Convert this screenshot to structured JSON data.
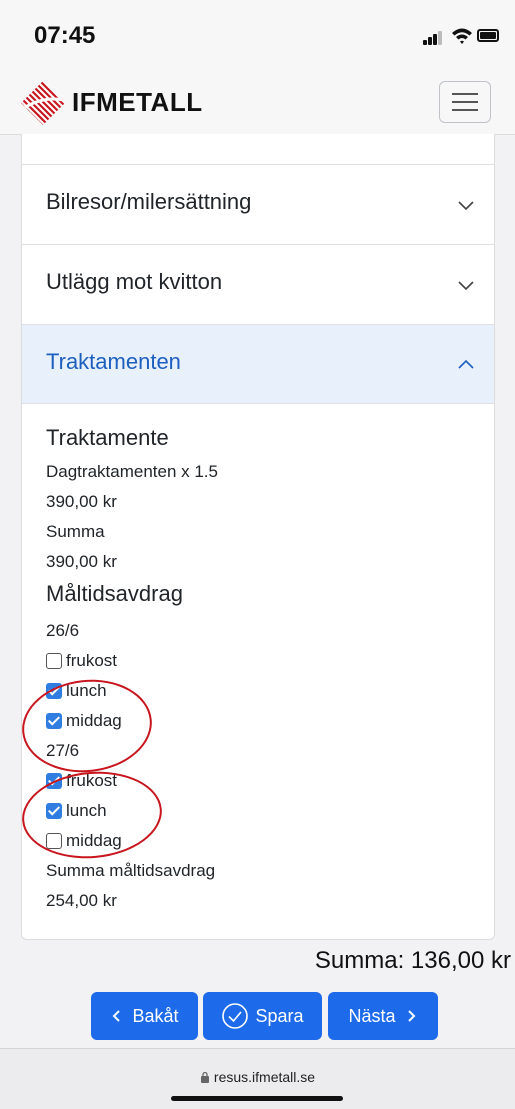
{
  "status": {
    "time": "07:45"
  },
  "navbar": {
    "brand": "IFMETALL"
  },
  "accordion": [
    {
      "label": "Bilresor/milersättning",
      "expanded": false
    },
    {
      "label": "Utlägg mot kvitton",
      "expanded": false
    },
    {
      "label": "Traktamenten",
      "expanded": true
    }
  ],
  "traktamente": {
    "heading": "Traktamente",
    "type": "Dagtraktamenten x 1.5",
    "amount": "390,00 kr",
    "summa_label": "Summa",
    "summa_value": "390,00 kr"
  },
  "maltid": {
    "heading": "Måltidsavdrag",
    "days": [
      {
        "date": "26/6",
        "items": [
          {
            "label": "frukost",
            "checked": false
          },
          {
            "label": "lunch",
            "checked": true
          },
          {
            "label": "middag",
            "checked": true
          }
        ]
      },
      {
        "date": "27/6",
        "items": [
          {
            "label": "frukost",
            "checked": true
          },
          {
            "label": "lunch",
            "checked": true
          },
          {
            "label": "middag",
            "checked": false
          }
        ]
      }
    ],
    "summa_label": "Summa måltidsavdrag",
    "summa_value": "254,00 kr"
  },
  "total": "Summa: 136,00 kr",
  "buttons": {
    "back": "Bakåt",
    "save": "Spara",
    "next": "Nästa"
  },
  "browser": {
    "url": "resus.ifmetall.se"
  },
  "colors": {
    "primary": "#1d6bea",
    "annotation": "#c8161f",
    "active_header": "#e7f0fb"
  }
}
